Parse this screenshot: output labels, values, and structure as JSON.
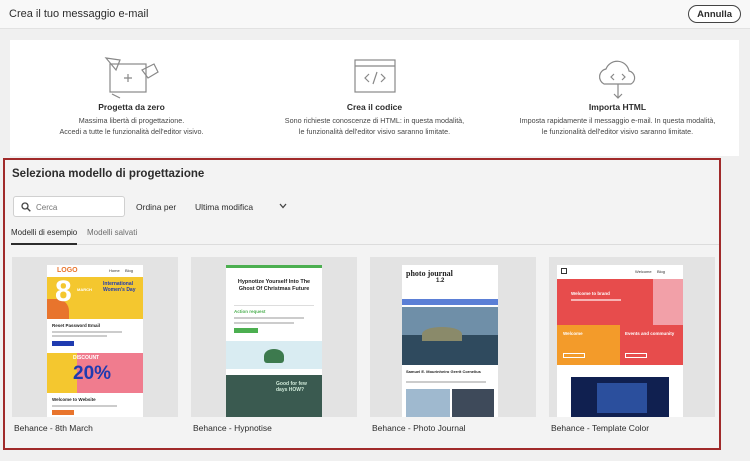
{
  "header": {
    "title": "Crea il tuo messaggio e-mail",
    "cancel_label": "Annulla"
  },
  "options": [
    {
      "icon": "design-from-scratch-icon",
      "title": "Progetta da zero",
      "line1": "Massima libertà di progettazione.",
      "line2": "Accedi a tutte le funzionalità dell'editor visivo."
    },
    {
      "icon": "code-icon",
      "title": "Crea il codice",
      "line1": "Sono richieste conoscenze di HTML: in questa modalità,",
      "line2": "le funzionalità dell'editor visivo saranno limitate."
    },
    {
      "icon": "cloud-import-icon",
      "title": "Importa HTML",
      "line1": "Imposta rapidamente il messaggio e-mail. In questa modalità,",
      "line2": "le funzionalità dell'editor visivo saranno limitate."
    }
  ],
  "templates_section": {
    "title": "Seleziona modello di progettazione",
    "search_placeholder": "Cerca",
    "sort_label": "Ordina per",
    "sort_value": "Ultima modifica",
    "tabs": [
      {
        "label": "Modelli di esempio",
        "active": true
      },
      {
        "label": "Modelli salvati",
        "active": false
      }
    ],
    "templates": [
      {
        "name": "Behance - 8th March",
        "preview": {
          "logo": "LOGO",
          "nav1": "Home",
          "nav2": "Blog",
          "big_number": "8",
          "month": "MARCH",
          "headline": "International Women's Day",
          "section1": "Reset Password Email",
          "discount": "DISCOUNT",
          "percent": "20%",
          "section2": "Welcome to Website"
        }
      },
      {
        "name": "Behance - Hypnotise",
        "preview": {
          "headline": "Hypnotize Yourself Into The Ghost Of Christmas Future",
          "section1": "Action request",
          "question": "Good for few days HOW?"
        }
      },
      {
        "name": "Behance - Photo Journal",
        "preview": {
          "title": "photo journal",
          "issue": "1.2",
          "author": "Samuel E. Mourinheiro Gerrit Cornelius"
        }
      },
      {
        "name": "Behance - Template Color",
        "preview": {
          "nav1": "Welcome",
          "nav2": "Blog",
          "welcome": "Welcome to brand",
          "tile1": "Welcome",
          "tile2": "Events and community"
        }
      }
    ]
  },
  "colors": {
    "panel_border": "#a02a2a",
    "march_yellow": "#f4c72f",
    "march_orange": "#e8742c",
    "march_pink": "#f07c8e",
    "march_blue": "#1f3bb0",
    "hypno_green": "#4caf50",
    "journal_blue": "#5b7fd6",
    "color_red": "#e74c4c",
    "color_pink": "#f2a0a8",
    "color_orange": "#f39b2a",
    "color_navy": "#102050"
  }
}
